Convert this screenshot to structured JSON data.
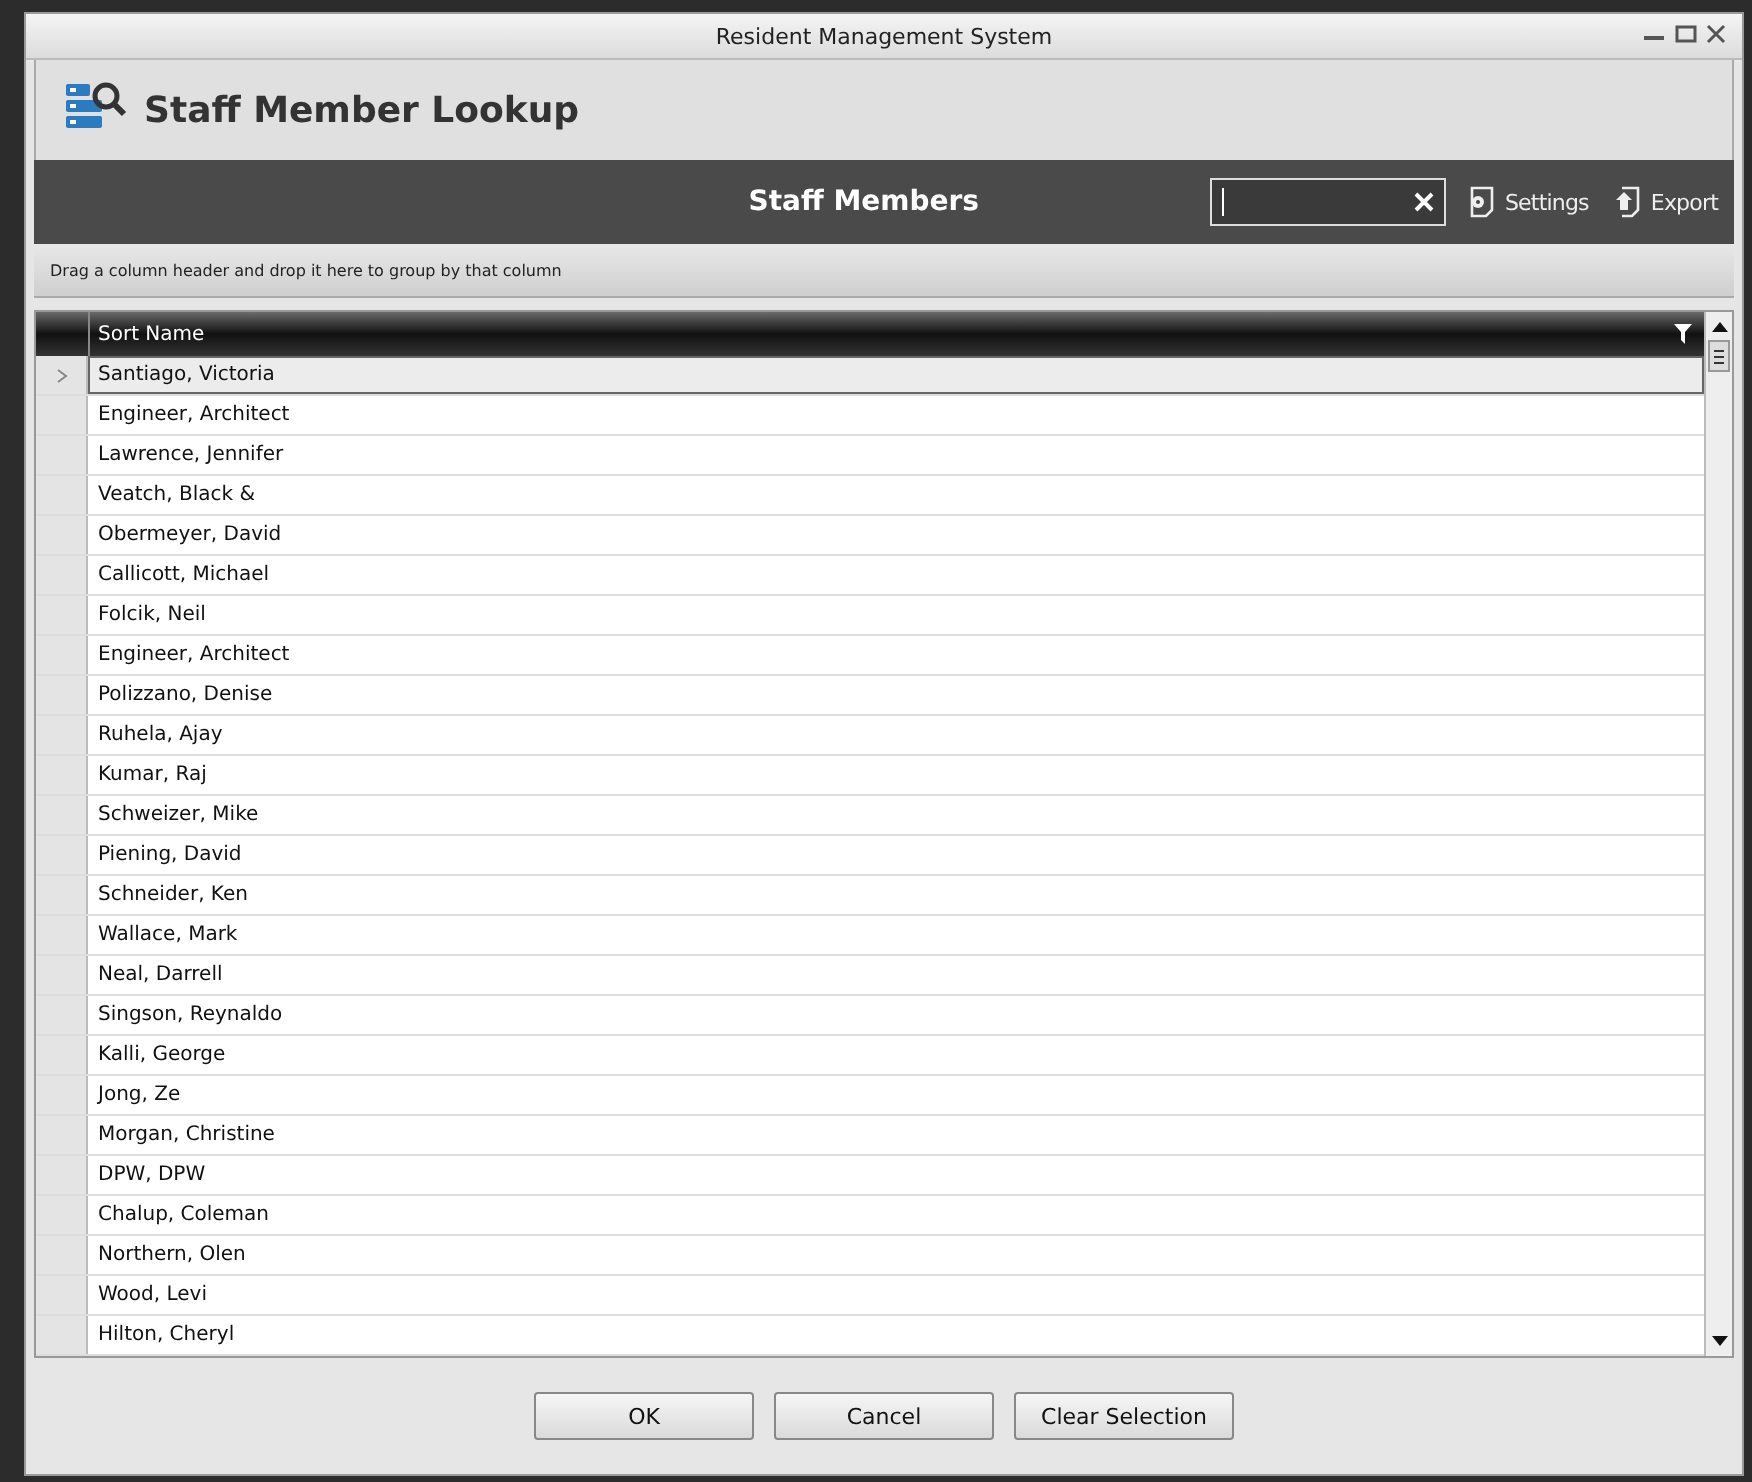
{
  "window": {
    "title": "Resident Management System"
  },
  "header": {
    "title": "Staff Member Lookup"
  },
  "toolbar": {
    "title": "Staff Members",
    "search": {
      "focused": true
    },
    "actions": [
      {
        "kind": "settings",
        "label": "Settings"
      },
      {
        "kind": "export",
        "label": "Export"
      }
    ]
  },
  "group_panel": {
    "hint": "Drag a column header and drop it here to group by that column"
  },
  "table": {
    "columns": [
      "Sort Name"
    ],
    "rows": [
      {
        "name": "Santiago, Victoria",
        "selected": true
      },
      {
        "name": "Engineer, Architect",
        "selected": false
      },
      {
        "name": "Lawrence, Jennifer",
        "selected": false
      },
      {
        "name": "Veatch, Black &",
        "selected": false
      },
      {
        "name": "Obermeyer, David",
        "selected": false
      },
      {
        "name": "Callicott, Michael",
        "selected": false
      },
      {
        "name": "Folcik, Neil",
        "selected": false
      },
      {
        "name": "Engineer, Architect",
        "selected": false
      },
      {
        "name": "Polizzano, Denise",
        "selected": false
      },
      {
        "name": "Ruhela, Ajay",
        "selected": false
      },
      {
        "name": "Kumar, Raj",
        "selected": false
      },
      {
        "name": "Schweizer, Mike",
        "selected": false
      },
      {
        "name": "Piening, David",
        "selected": false
      },
      {
        "name": "Schneider, Ken",
        "selected": false
      },
      {
        "name": "Wallace, Mark",
        "selected": false
      },
      {
        "name": "Neal, Darrell",
        "selected": false
      },
      {
        "name": "Singson, Reynaldo",
        "selected": false
      },
      {
        "name": "Kalli, George",
        "selected": false
      },
      {
        "name": "Jong, Ze",
        "selected": false
      },
      {
        "name": "Morgan, Christine",
        "selected": false
      },
      {
        "name": "DPW, DPW",
        "selected": false
      },
      {
        "name": "Chalup, Coleman",
        "selected": false
      },
      {
        "name": "Northern, Olen",
        "selected": false
      },
      {
        "name": "Wood, Levi",
        "selected": false
      },
      {
        "name": "Hilton, Cheryl",
        "selected": false
      }
    ]
  },
  "buttons": [
    "OK",
    "Cancel",
    "Clear Selection"
  ]
}
